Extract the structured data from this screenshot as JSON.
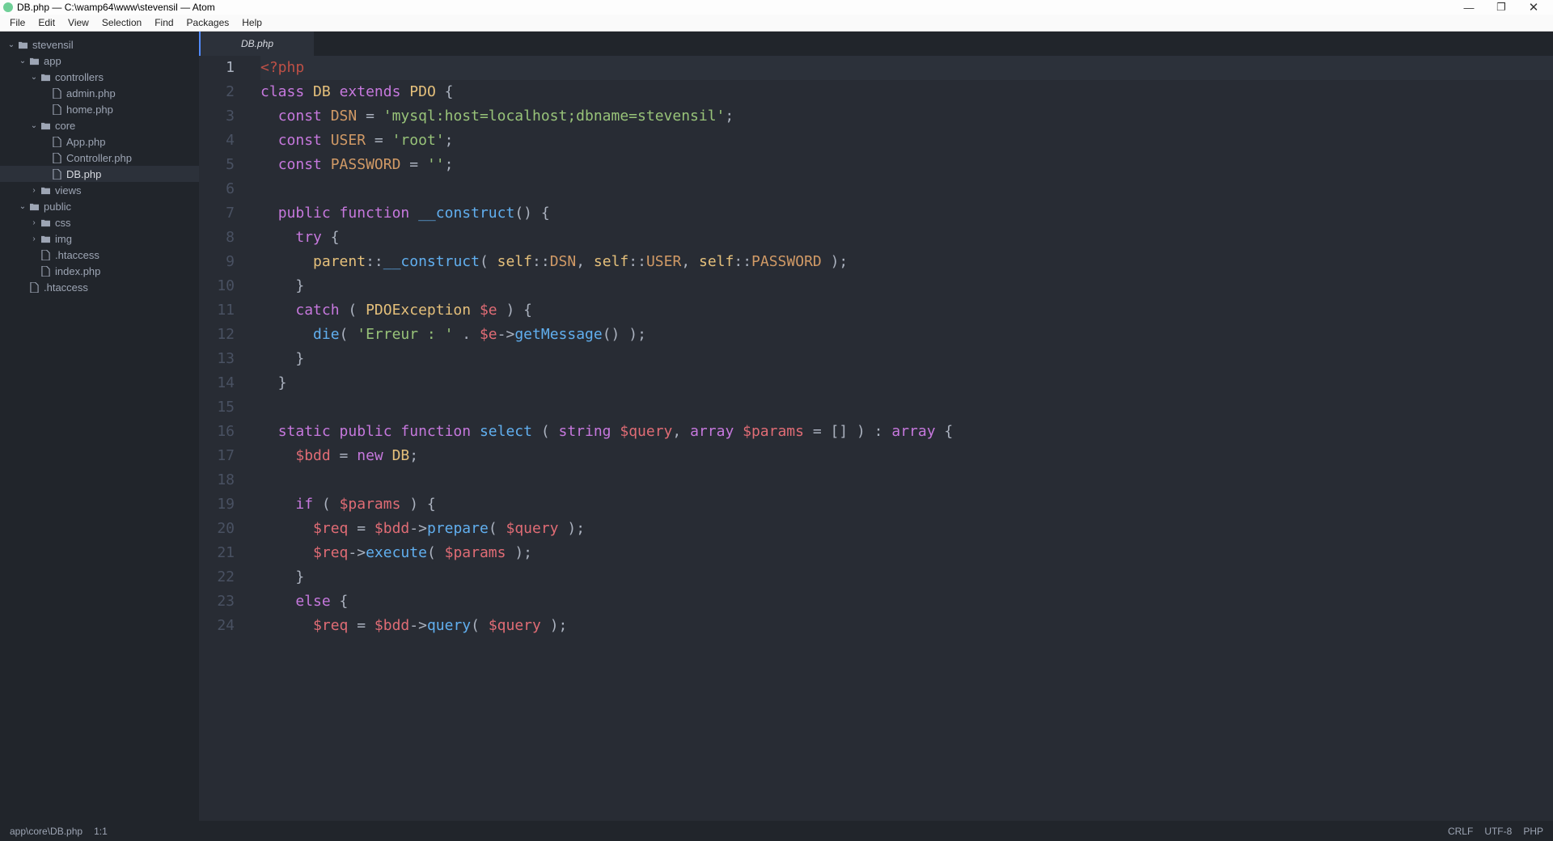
{
  "window": {
    "title": "DB.php — C:\\wamp64\\www\\stevensil — Atom",
    "controls": {
      "minimize": "—",
      "maximize": "❐",
      "close": "✕"
    }
  },
  "menu": [
    "File",
    "Edit",
    "View",
    "Selection",
    "Find",
    "Packages",
    "Help"
  ],
  "tree": [
    {
      "depth": 0,
      "kind": "folder",
      "open": true,
      "label": "stevensil"
    },
    {
      "depth": 1,
      "kind": "folder",
      "open": true,
      "label": "app"
    },
    {
      "depth": 2,
      "kind": "folder",
      "open": true,
      "label": "controllers"
    },
    {
      "depth": 3,
      "kind": "file",
      "label": "admin.php"
    },
    {
      "depth": 3,
      "kind": "file",
      "label": "home.php"
    },
    {
      "depth": 2,
      "kind": "folder",
      "open": true,
      "label": "core"
    },
    {
      "depth": 3,
      "kind": "file",
      "label": "App.php"
    },
    {
      "depth": 3,
      "kind": "file",
      "label": "Controller.php"
    },
    {
      "depth": 3,
      "kind": "file",
      "selected": true,
      "label": "DB.php"
    },
    {
      "depth": 2,
      "kind": "folder",
      "open": false,
      "label": "views"
    },
    {
      "depth": 1,
      "kind": "folder",
      "open": true,
      "label": "public"
    },
    {
      "depth": 2,
      "kind": "folder",
      "open": false,
      "label": "css"
    },
    {
      "depth": 2,
      "kind": "folder",
      "open": false,
      "label": "img"
    },
    {
      "depth": 2,
      "kind": "file",
      "label": ".htaccess"
    },
    {
      "depth": 2,
      "kind": "file",
      "label": "index.php"
    },
    {
      "depth": 1,
      "kind": "file",
      "label": ".htaccess"
    }
  ],
  "tab": {
    "title": "DB.php"
  },
  "status": {
    "path": "app\\core\\DB.php",
    "position": "1:1",
    "eol": "CRLF",
    "encoding": "UTF-8",
    "language": "PHP"
  },
  "code": {
    "active_line": 1,
    "lines": [
      [
        {
          "t": "<?php",
          "c": "php"
        }
      ],
      [
        {
          "t": "class ",
          "c": "k"
        },
        {
          "t": "DB",
          "c": "cls"
        },
        {
          "t": " "
        },
        {
          "t": "extends ",
          "c": "k"
        },
        {
          "t": "PDO",
          "c": "cls"
        },
        {
          "t": " {",
          "c": "pun"
        }
      ],
      [
        {
          "t": "  "
        },
        {
          "t": "const ",
          "c": "k"
        },
        {
          "t": "DSN",
          "c": "con"
        },
        {
          "t": " = "
        },
        {
          "t": "'mysql:host=localhost;dbname=stevensil'",
          "c": "str"
        },
        {
          "t": ";",
          "c": "pun"
        }
      ],
      [
        {
          "t": "  "
        },
        {
          "t": "const ",
          "c": "k"
        },
        {
          "t": "USER",
          "c": "con"
        },
        {
          "t": " = "
        },
        {
          "t": "'root'",
          "c": "str"
        },
        {
          "t": ";",
          "c": "pun"
        }
      ],
      [
        {
          "t": "  "
        },
        {
          "t": "const ",
          "c": "k"
        },
        {
          "t": "PASSWORD",
          "c": "con"
        },
        {
          "t": " = "
        },
        {
          "t": "''",
          "c": "str"
        },
        {
          "t": ";",
          "c": "pun"
        }
      ],
      [],
      [
        {
          "t": "  "
        },
        {
          "t": "public ",
          "c": "k"
        },
        {
          "t": "function ",
          "c": "k"
        },
        {
          "t": "__construct",
          "c": "fn"
        },
        {
          "t": "() {",
          "c": "pun"
        }
      ],
      [
        {
          "t": "    "
        },
        {
          "t": "try",
          "c": "k"
        },
        {
          "t": " {",
          "c": "pun"
        }
      ],
      [
        {
          "t": "      "
        },
        {
          "t": "parent",
          "c": "self"
        },
        {
          "t": "::",
          "c": "pun"
        },
        {
          "t": "__construct",
          "c": "fn"
        },
        {
          "t": "( ",
          "c": "pun"
        },
        {
          "t": "self",
          "c": "self"
        },
        {
          "t": "::",
          "c": "pun"
        },
        {
          "t": "DSN",
          "c": "con"
        },
        {
          "t": ", ",
          "c": "pun"
        },
        {
          "t": "self",
          "c": "self"
        },
        {
          "t": "::",
          "c": "pun"
        },
        {
          "t": "USER",
          "c": "con"
        },
        {
          "t": ", ",
          "c": "pun"
        },
        {
          "t": "self",
          "c": "self"
        },
        {
          "t": "::",
          "c": "pun"
        },
        {
          "t": "PASSWORD",
          "c": "con"
        },
        {
          "t": " );",
          "c": "pun"
        }
      ],
      [
        {
          "t": "    }",
          "c": "pun"
        }
      ],
      [
        {
          "t": "    "
        },
        {
          "t": "catch",
          "c": "k"
        },
        {
          "t": " ( ",
          "c": "pun"
        },
        {
          "t": "PDOException",
          "c": "cls"
        },
        {
          "t": " "
        },
        {
          "t": "$e",
          "c": "var"
        },
        {
          "t": " ) {",
          "c": "pun"
        }
      ],
      [
        {
          "t": "      "
        },
        {
          "t": "die",
          "c": "fn"
        },
        {
          "t": "( ",
          "c": "pun"
        },
        {
          "t": "'Erreur : '",
          "c": "str"
        },
        {
          "t": " . ",
          "c": "pun"
        },
        {
          "t": "$e",
          "c": "var"
        },
        {
          "t": "->",
          "c": "pun"
        },
        {
          "t": "getMessage",
          "c": "fn"
        },
        {
          "t": "() );",
          "c": "pun"
        }
      ],
      [
        {
          "t": "    }",
          "c": "pun"
        }
      ],
      [
        {
          "t": "  }",
          "c": "pun"
        }
      ],
      [],
      [
        {
          "t": "  "
        },
        {
          "t": "static ",
          "c": "k"
        },
        {
          "t": "public ",
          "c": "k"
        },
        {
          "t": "function ",
          "c": "k"
        },
        {
          "t": "select",
          "c": "fn"
        },
        {
          "t": " ( ",
          "c": "pun"
        },
        {
          "t": "string",
          "c": "k"
        },
        {
          "t": " "
        },
        {
          "t": "$query",
          "c": "var"
        },
        {
          "t": ", ",
          "c": "pun"
        },
        {
          "t": "array",
          "c": "k"
        },
        {
          "t": " "
        },
        {
          "t": "$params",
          "c": "var"
        },
        {
          "t": " = [] ) : ",
          "c": "pun"
        },
        {
          "t": "array",
          "c": "k"
        },
        {
          "t": " {",
          "c": "pun"
        }
      ],
      [
        {
          "t": "    "
        },
        {
          "t": "$bdd",
          "c": "var"
        },
        {
          "t": " = ",
          "c": "pun"
        },
        {
          "t": "new ",
          "c": "k"
        },
        {
          "t": "DB",
          "c": "cls"
        },
        {
          "t": ";",
          "c": "pun"
        }
      ],
      [],
      [
        {
          "t": "    "
        },
        {
          "t": "if",
          "c": "k"
        },
        {
          "t": " ( ",
          "c": "pun"
        },
        {
          "t": "$params",
          "c": "var"
        },
        {
          "t": " ) {",
          "c": "pun"
        }
      ],
      [
        {
          "t": "      "
        },
        {
          "t": "$req",
          "c": "var"
        },
        {
          "t": " = ",
          "c": "pun"
        },
        {
          "t": "$bdd",
          "c": "var"
        },
        {
          "t": "->",
          "c": "pun"
        },
        {
          "t": "prepare",
          "c": "fn"
        },
        {
          "t": "( ",
          "c": "pun"
        },
        {
          "t": "$query",
          "c": "var"
        },
        {
          "t": " );",
          "c": "pun"
        }
      ],
      [
        {
          "t": "      "
        },
        {
          "t": "$req",
          "c": "var"
        },
        {
          "t": "->",
          "c": "pun"
        },
        {
          "t": "execute",
          "c": "fn"
        },
        {
          "t": "( ",
          "c": "pun"
        },
        {
          "t": "$params",
          "c": "var"
        },
        {
          "t": " );",
          "c": "pun"
        }
      ],
      [
        {
          "t": "    }",
          "c": "pun"
        }
      ],
      [
        {
          "t": "    "
        },
        {
          "t": "else",
          "c": "k"
        },
        {
          "t": " {",
          "c": "pun"
        }
      ],
      [
        {
          "t": "      "
        },
        {
          "t": "$req",
          "c": "var"
        },
        {
          "t": " = ",
          "c": "pun"
        },
        {
          "t": "$bdd",
          "c": "var"
        },
        {
          "t": "->",
          "c": "pun"
        },
        {
          "t": "query",
          "c": "fn"
        },
        {
          "t": "( ",
          "c": "pun"
        },
        {
          "t": "$query",
          "c": "var"
        },
        {
          "t": " );",
          "c": "pun"
        }
      ]
    ]
  }
}
